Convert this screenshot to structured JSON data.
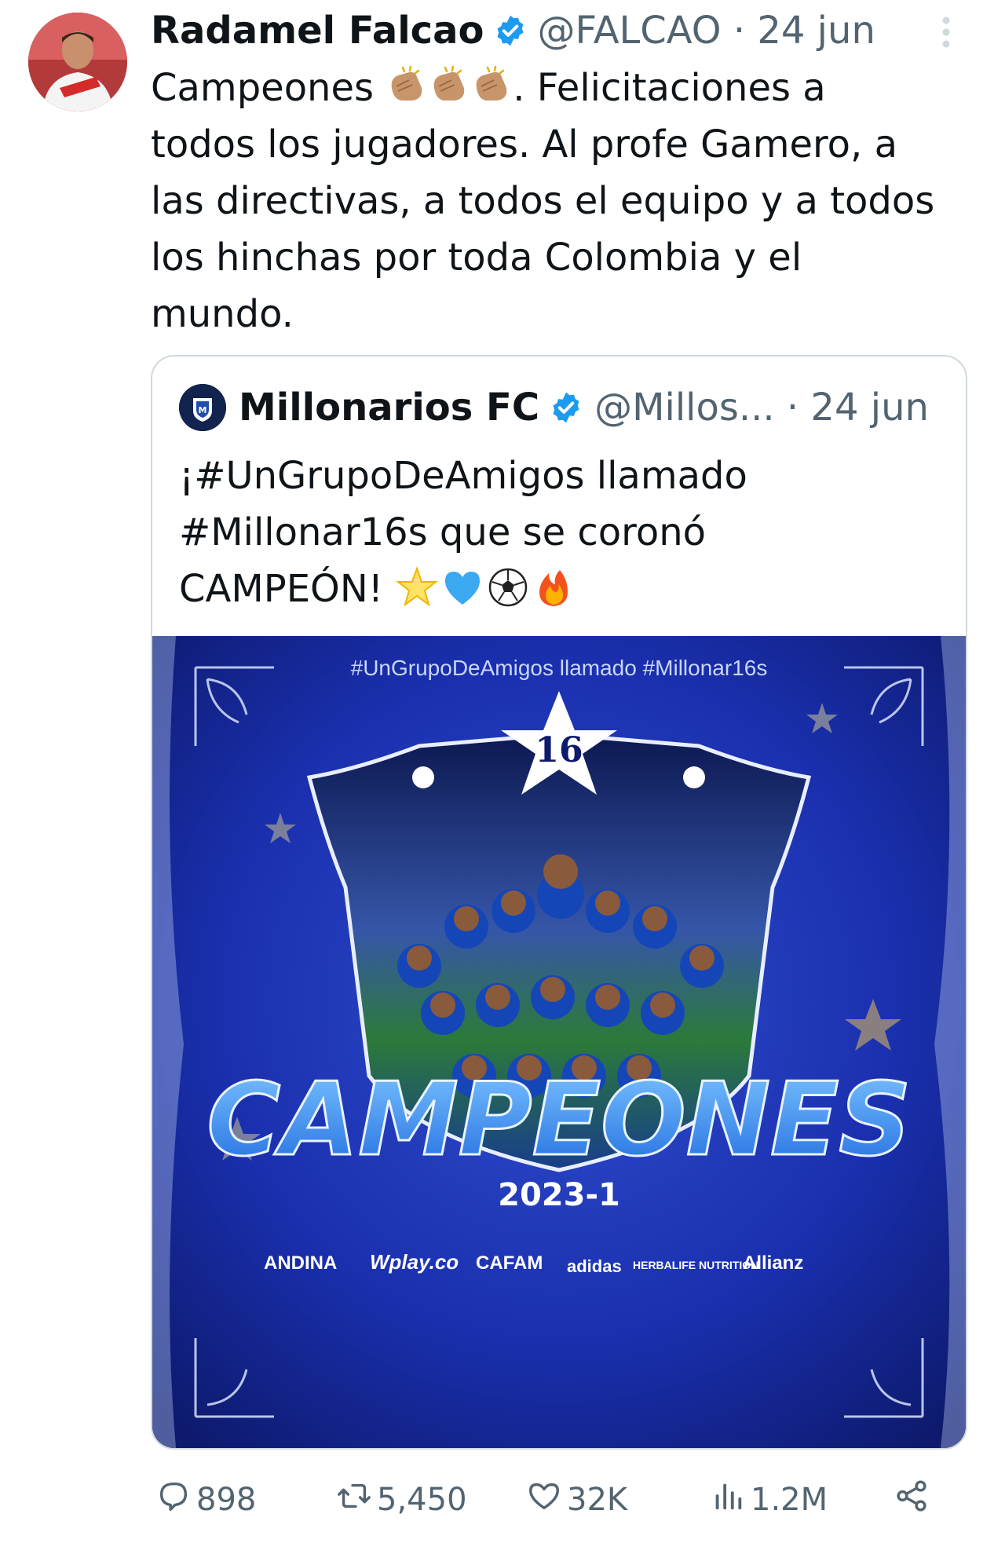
{
  "tweet": {
    "author_name": "Radamel Falcao",
    "handle": "@FALCAO",
    "date": "24 jun",
    "text_line1_a": "Campeones ",
    "text_line1_b": ". Felicitaciones a",
    "text_rest": "todos los jugadores. Al profe Gamero, a\nlas directivas, a todos el equipo y a todos\nlos hinchas por toda Colombia y el\nmundo."
  },
  "quote": {
    "author_name": "Millonarios FC",
    "handle": "@Millos...",
    "date": "24 jun",
    "text_main": "¡#UnGrupoDeAmigos llamado\n#Millonar16s que se coronó\nCAMPEÓN! ",
    "image": {
      "hashtag_line": "#UnGrupoDeAmigos llamado #Millonar16s",
      "star_number": "16",
      "big_title": "CAMPEONES",
      "year": "2023-1",
      "sponsors": [
        "ANDINA",
        "Wplay.co",
        "CAFAM",
        "adidas",
        "HERBALIFE NUTRITION",
        "Allianz"
      ]
    }
  },
  "actions": {
    "replies": "898",
    "retweets": "5,450",
    "likes": "32K",
    "views": "1.2M"
  },
  "colors": {
    "verified": "#1d9bf0",
    "secondary_text": "#536471",
    "border": "#cfd9de",
    "poster_blue": "#1a2fae"
  },
  "icons": [
    "verified-badge-icon",
    "more-options-icon",
    "clapping-hands-emoji",
    "star-emoji",
    "blue-heart-emoji",
    "soccer-ball-emoji",
    "fire-emoji",
    "reply-icon",
    "retweet-icon",
    "like-icon",
    "views-icon",
    "share-icon"
  ]
}
